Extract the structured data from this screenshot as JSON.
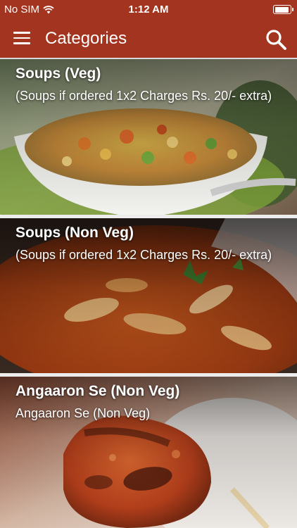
{
  "status_bar": {
    "carrier": "No SIM",
    "time": "1:12 AM",
    "battery_level": 0.95
  },
  "app_bar": {
    "title": "Categories",
    "menu_icon": "hamburger-menu-icon",
    "search_icon": "search-icon",
    "color": "#a3341f"
  },
  "categories": [
    {
      "name": "Soups (Veg)",
      "description": "(Soups if ordered 1x2 Charges Rs. 20/- extra)",
      "image": "vegetable-soup-bowl"
    },
    {
      "name": "Soups (Non Veg)",
      "description": "(Soups if ordered 1x2 Charges Rs. 20/- extra)",
      "image": "chicken-soup"
    },
    {
      "name": "Angaaron Se (Non Veg)",
      "description": "Angaaron Se (Non Veg)",
      "image": "grilled-kebab-skewer"
    }
  ]
}
